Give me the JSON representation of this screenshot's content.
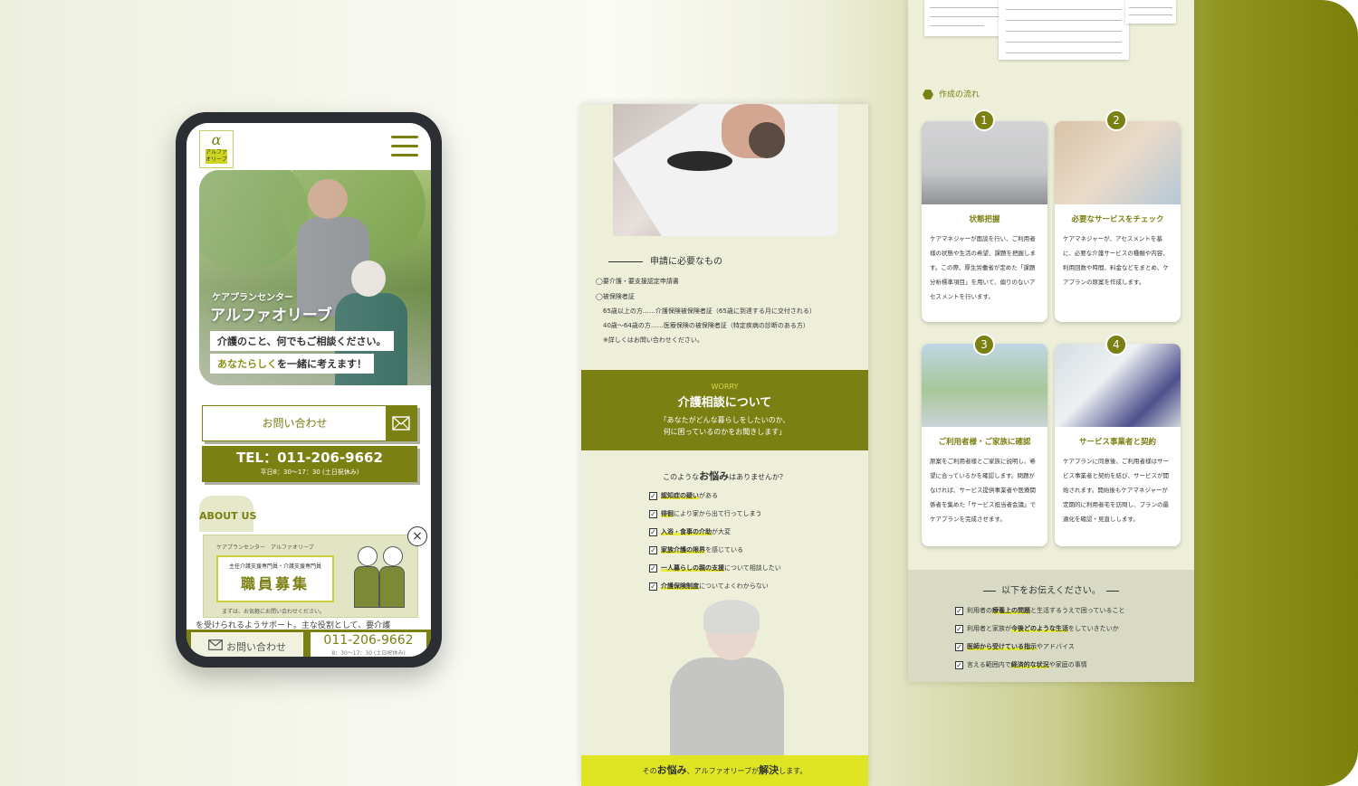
{
  "phone": {
    "logo_mark": "α",
    "logo_text": "アルファ オリーブ",
    "hero": {
      "subtitle": "ケアプランセンター",
      "title": "アルファオリーブ",
      "line1": "介護のこと、何でもご相談ください。",
      "line2_highlight": "あなたらしく",
      "line2_rest": "を一緒に考えます！"
    },
    "contact_label": "お問い合わせ",
    "tel_number": "TEL：011-206-9662",
    "tel_hours": "平日8：30〜17：30 (土日祝休み)",
    "about_label": "ABOUT US",
    "about_text": "を受けられるようサポート。主な役割として、要介護",
    "recruit": {
      "org": "ケアプランセンター　アルファオリーブ",
      "roles": "主任介護支援専門員・介護支援専門員",
      "title": "職員募集",
      "note": "まずは、お気軽にお問い合わせください。"
    },
    "close_label": "×",
    "bottom_contact": "お問い合わせ",
    "bottom_tel": "011-206-9662",
    "bottom_hours": "8：30〜17：30 (土日祝休み)"
  },
  "middle": {
    "required_title": "申請に必要なもの",
    "required_items": [
      "◯要介護・要支援認定申請書",
      "◯被保険者証"
    ],
    "required_sub": [
      "65歳以上の方……介護保険被保険者証（65歳に到達する月に交付される）",
      "40歳〜64歳の方……医療保険の被保険者証（特定疾病の診断のある方）",
      "※詳しくはお問い合わせください。"
    ],
    "worry": {
      "en": "WORRY",
      "title": "介護相談について",
      "quote1": "「あなたがどんな暮らしをしたいのか、",
      "quote2": "何に困っているのかをお聞きします」"
    },
    "ask_prefix": "このような",
    "ask_bold": "お悩み",
    "ask_suffix": "はありませんか？",
    "checks": [
      {
        "hl": "認知症の疑い",
        "rest": "がある"
      },
      {
        "hl": "徘徊",
        "rest": "により家から出て行ってしまう"
      },
      {
        "hl": "入浴・食事の介助",
        "rest": "が大変"
      },
      {
        "hl": "家族介護の限界",
        "rest": "を感じている"
      },
      {
        "hl": "一人暮らしの親の支援",
        "rest": "について相談したい"
      },
      {
        "hl": "介護保険制度",
        "rest": "についてよくわからない"
      }
    ],
    "footer_pre": "その",
    "footer_bold1": "お悩み",
    "footer_mid": "、アルファオリーブが",
    "footer_bold2": "解決",
    "footer_post": "します。"
  },
  "right": {
    "flow_title": "作成の流れ",
    "steps": [
      {
        "num": "1",
        "title": "状態把握",
        "text": "ケアマネジャーが面談を行い、ご利用者様の状態や生活の希望、課題を把握します。この際、厚生労働省が定めた「課題分析標準項目」を用いて、偏りのないアセスメントを行います。"
      },
      {
        "num": "2",
        "title": "必要なサービスをチェック",
        "text": "ケアマネジャーが、アセスメントを基に、必要な介護サービスの種類や内容、利用回数や時間、料金などをまとめ、ケアプランの原案を作成します。"
      },
      {
        "num": "3",
        "title": "ご利用者様・ご家族に確認",
        "text": "原案をご利用者様とご家族に説明し、希望に合っているかを確認します。問題がなければ、サービス提供事業者や医療関係者を集めた「サービス担当者会議」でケアプランを完成させます。"
      },
      {
        "num": "4",
        "title": "サービス事業者と契約",
        "text": "ケアプランに同意後、ご利用者様はサービス事業者と契約を結び、サービスが開始されます。開始後もケアマネジャーが定期的に利用者宅を訪問し、プランの最適化を確認・見直しします。"
      }
    ],
    "convey_title": "以下をお伝えください。",
    "convey_items": [
      {
        "pre": "利用者の",
        "hl": "療養上の問題",
        "post": "と生活するうえで困っていること"
      },
      {
        "pre": "利用者と家族が",
        "hl": "今後どのような生活",
        "post": "をしていきたいか"
      },
      {
        "pre": "",
        "hl": "医師から受けている指示",
        "post": "やアドバイス"
      },
      {
        "pre": "言える範囲内で",
        "hl": "経済的な状況",
        "post": "や家庭の事情"
      }
    ]
  }
}
